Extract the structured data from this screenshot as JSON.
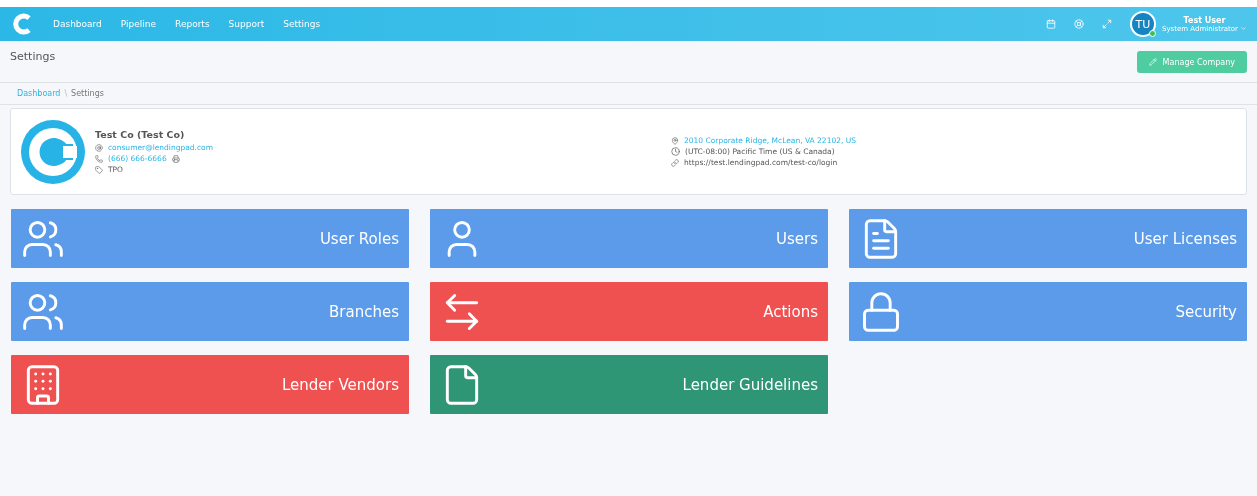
{
  "nav": {
    "items": [
      "Dashboard",
      "Pipeline",
      "Reports",
      "Support",
      "Settings"
    ]
  },
  "user": {
    "initials": "TU",
    "name": "Test User",
    "role": "System Administrator",
    "online": true
  },
  "page": {
    "title": "Settings",
    "action": "Manage Company"
  },
  "breadcrumb": [
    "Dashboard",
    "Settings"
  ],
  "breadcrumb_separator": "\\",
  "company": {
    "name": "Test Co (Test Co)",
    "email": "consumer@lendingpad.com",
    "phone": "(666) 666-6666",
    "type": "TPO",
    "address": "2010 Corporate Ridge, McLean, VA 22102, US",
    "timezone": "(UTC-08:00) Pacific Time (US & Canada)",
    "url": "https://test.lendingpad.com/test-co/login"
  },
  "tiles": [
    {
      "label": "User Roles",
      "color": "#5b9be9"
    },
    {
      "label": "Users",
      "color": "#5b9be9"
    },
    {
      "label": "User Licenses",
      "color": "#5b9be9"
    },
    {
      "label": "Branches",
      "color": "#5b9be9"
    },
    {
      "label": "Actions",
      "color": "#ef5050"
    },
    {
      "label": "Security",
      "color": "#5b9be9"
    },
    {
      "label": "Lender Vendors",
      "color": "#ef5050"
    },
    {
      "label": "Lender Guidelines",
      "color": "#2e9575"
    }
  ]
}
